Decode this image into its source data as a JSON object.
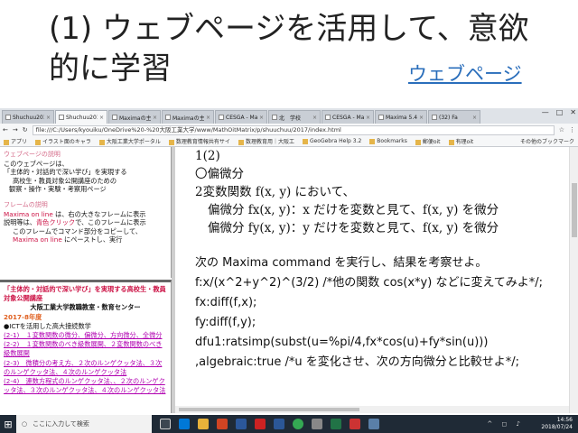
{
  "slide": {
    "title": "(1) ウェブページを活用して、意欲的に学習",
    "link": "ウェブページ"
  },
  "browser": {
    "tabs": [
      {
        "label": "Shuchuu2017"
      },
      {
        "label": "Shuchuu2017"
      },
      {
        "label": "Maximaの主"
      },
      {
        "label": "Maximaの主"
      },
      {
        "label": "CESGA - Ma"
      },
      {
        "label": "北　学校"
      },
      {
        "label": "CESGA - Ma"
      },
      {
        "label": "Maxima 5.4"
      },
      {
        "label": "(32) Fa"
      }
    ],
    "url": "file:///C:/Users/kyouiku/OneDrive%20-%20大阪工業大学/www/MathOitMatrix/p/shuuchuu/2017/index.html",
    "bookmarks": [
      "アプリ",
      "イラスト面のキャラ",
      "大阪工業大学ポータル",
      "数理教育情報共有サイ",
      "数理教育用｜大阪工",
      "GeoGebra Help 3.2",
      "Bookmarks",
      "郵便oit",
      "有理oit"
    ],
    "bookmarks_right": "その他のブックマーク"
  },
  "left_top": {
    "section1_title": "ウェブページの説明",
    "l1": "このウェブページは、",
    "l2": "「主体的・対話的で深い学び」を実現する",
    "l3": "高校生・教員対象公開講座のための",
    "l4": "観察・操作・実験・考察用ページ",
    "section2_title": "フレームの説明",
    "f1a": "Maxima on line",
    "f1b": " は、右の大きなフレームに表示",
    "f2a": "説明等は、",
    "f2b": "青色クリック",
    "f2c": "で、このフレームに表示",
    "f3": "このフレームでコマンド部分をコピーして、",
    "f4a": "Maxima on line",
    "f4b": " にペーストし、実行"
  },
  "left_bottom": {
    "h1": "「主体的・対話的で深い学び」を実現する高校生・教員対象公開講座",
    "h2": "大阪工業大学教職教室・数育センター",
    "h3": "2017-8年度",
    "h4": "●ICTを活用した高大接続数学",
    "items": [
      "(2-1)　１変数関数の微分、偏微分、方向微分、全微分",
      "(2-2)　１変数関数のべき級数展開、２変数関数のべき級数展開",
      "(2-3)　微積分の考え方、２次のルンゲクッタ法、３次のルンゲクッタ法、４次のルンゲクッタ法",
      "(2-4)　連数方程式のルンゲクッタ法、、２次のルンゲクッタ法、３次のルンゲクッタ法、４次のルンゲクッタ法"
    ]
  },
  "main": {
    "l0": "1(2)",
    "l1": "〇偏微分",
    "l2": "2変数関数 f(x, y) において、",
    "l3": "偏微分 fx(x, y)：x だけを変数と見て、f(x, y) を微分",
    "l4": "偏微分 fy(x, y)：y だけを変数と見て、f(x, y) を微分",
    "c1": "次の Maxima command を実行し、結果を考察せよ。",
    "c2": "f:x/(x^2+y^2)^(3/2) /*他の関数 cos(x*y) などに変えてみよ*/;",
    "c3": "fx:diff(f,x);",
    "c4": "fy:diff(f,y);",
    "c5": "dfu1:ratsimp(subst(u=%pi/4,fx*cos(u)+fy*sin(u)))",
    "c6": ",algebraic:true /*u を変化させ、次の方向微分と比較せよ*/;"
  },
  "taskbar": {
    "search_placeholder": "ここに入力して検索",
    "time": "14:56",
    "date": "2018/07/24"
  },
  "colors": {
    "accent": "#2a6ebb",
    "red": "#cc1144",
    "magenta": "#cc11aa",
    "taskbar": "#1f2a36"
  }
}
